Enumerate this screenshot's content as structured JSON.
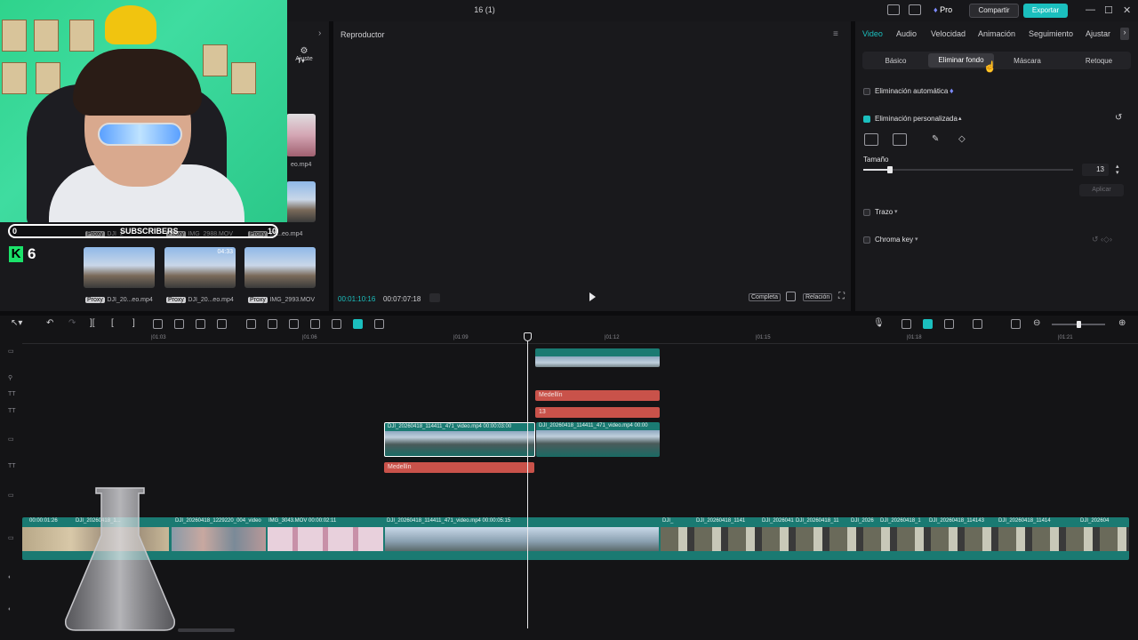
{
  "titlebar": {
    "title": "16 (1)",
    "pro": "Pro",
    "share": "Compartir",
    "export": "Exportar"
  },
  "overlay": {
    "sub_start": "0",
    "sub_label": "SUBSCRIBERS",
    "sub_goal": "10",
    "kick_count": "6"
  },
  "media": {
    "adjust": "Ajuste",
    "files": [
      {
        "name": "eo.mp4",
        "proxy": "Proxy"
      },
      {
        "name": "DJI_2",
        "proxy": "Proxy"
      },
      {
        "name": "IMG_2988.MOV",
        "proxy": "Proxy"
      },
      {
        "name": "20...eo.mp4",
        "proxy": "Proxy"
      },
      {
        "name": "DJI_20...eo.mp4",
        "proxy": "Proxy"
      },
      {
        "name": "DJI_20...eo.mp4",
        "proxy": "Proxy"
      },
      {
        "name": "IMG_2993.MOV",
        "proxy": "Proxy"
      }
    ],
    "thumb_time": "04:33"
  },
  "player": {
    "title": "Reproductor",
    "current": "00:01:10:16",
    "total": "00:07:07:18",
    "full": "Completa",
    "ratio": "Relación"
  },
  "inspector": {
    "tabs": [
      "Video",
      "Audio",
      "Velocidad",
      "Animación",
      "Seguimiento",
      "Ajustar"
    ],
    "subtabs": [
      "Básico",
      "Eliminar fondo",
      "Máscara",
      "Retoque"
    ],
    "auto": "Eliminación automática",
    "custom": "Eliminación personalizada",
    "size_label": "Tamaño",
    "size_value": "13",
    "apply": "Aplicar",
    "stroke": "Trazo",
    "chroma": "Chroma key"
  },
  "timeline": {
    "ticks": [
      "|01:03",
      "|01:06",
      "|01:09",
      "|01:12",
      "|01:15",
      "|01:18",
      "|01:21"
    ],
    "text_clips": [
      "Medellín",
      "13",
      "Medellín"
    ],
    "clip_a": "DJI_20260418_114411_471_video.mp4   00:00:03:00",
    "clip_b": "DJI_20260418_114411_471_video.mp4   00:00",
    "main_labels": [
      "00:00:01:26",
      "DJI_20260418_1...",
      "DJI_20260418_1229220_004_video",
      "IMG_3043.MOV   00:00:02:11",
      "DJI_20260418_114411_471_video.mp4   00:00:05:15",
      "DJI_",
      "DJI_20260418_1141",
      "DJI_2026041",
      "DJI_20260418_11",
      "DJI_2026",
      "DJI_20260418_1",
      "DJI_20260418_114143",
      "DJI_20260418_11414",
      "DJI_202604"
    ]
  },
  "colors": {
    "accent": "#1bbfbe",
    "text_clip": "#c9524a",
    "video_clip": "#1a7a72"
  }
}
